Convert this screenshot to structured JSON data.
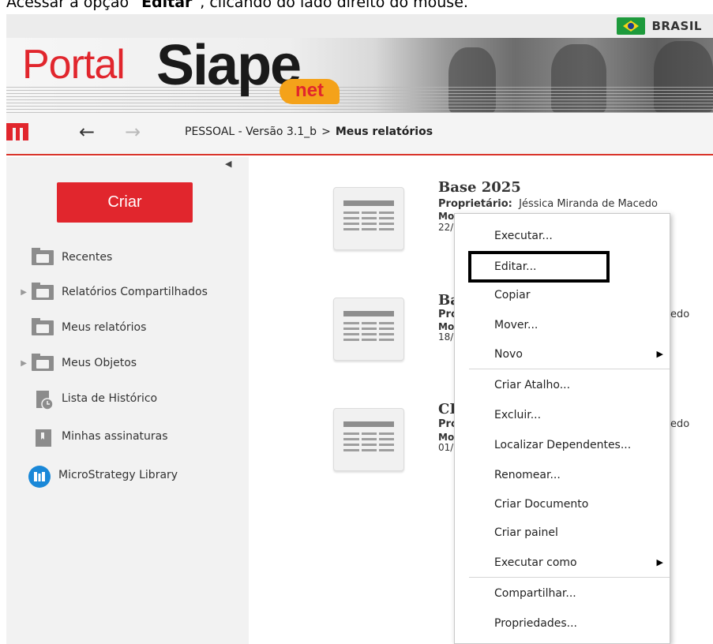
{
  "caption": {
    "text_prefix": "Acessar a opção “",
    "text_bold": "Editar",
    "text_suffix": "”, clicando do lado direito do mouse."
  },
  "topbar": {
    "country_label": "BRASIL",
    "flag_icon": "brazil-flag-icon"
  },
  "banner": {
    "logo_portal": "Portal",
    "logo_siape": "Siape",
    "logo_net": "net"
  },
  "nav": {
    "logo_icon": "microstrategy-m-icon",
    "back_icon": "arrow-left-icon",
    "forward_icon": "arrow-right-icon",
    "breadcrumb_root": "PESSOAL - Versão 3.1_b",
    "breadcrumb_sep": ">",
    "breadcrumb_current": "Meus relatórios"
  },
  "sidebar": {
    "collapse_icon": "collapse-left-icon",
    "create_label": "Criar",
    "items": [
      {
        "label": "Recentes",
        "icon": "clock-folder-icon",
        "expandable": false
      },
      {
        "label": "Relatórios Compartilhados",
        "icon": "shared-folder-icon",
        "expandable": true
      },
      {
        "label": "Meus relatórios",
        "icon": "user-folder-icon",
        "expandable": false
      },
      {
        "label": "Meus Objetos",
        "icon": "objects-folder-icon",
        "expandable": true
      },
      {
        "label": "Lista de Histórico",
        "icon": "history-icon",
        "expandable": false
      },
      {
        "label": "Minhas assinaturas",
        "icon": "bookmark-icon",
        "expandable": false
      },
      {
        "label": "MicroStrategy Library",
        "icon": "library-icon",
        "expandable": false
      }
    ]
  },
  "documents": [
    {
      "title": "Base 2025",
      "owner_label": "Proprietário:",
      "owner": "Jéssica Miranda de Macedo",
      "meta_visible": "Mo",
      "date_visible": "22/("
    },
    {
      "title": "Ba",
      "owner_label": "Pro",
      "owner_tail": "edo",
      "meta_visible": "Mo",
      "date_visible": "18/("
    },
    {
      "title": "CH",
      "owner_label": "Pro",
      "owner_tail": "edo",
      "meta_visible": "Mo",
      "date_visible": "01/("
    }
  ],
  "context_menu": {
    "items": [
      {
        "label": "Executar...",
        "submenu": false
      },
      {
        "label": "Editar...",
        "submenu": false,
        "highlighted": true
      },
      {
        "label": "Copiar",
        "submenu": false
      },
      {
        "label": "Mover...",
        "submenu": false
      },
      {
        "label": "Novo",
        "submenu": true
      },
      {
        "label": "Criar Atalho...",
        "submenu": false
      },
      {
        "label": "Excluir...",
        "submenu": false
      },
      {
        "label": "Localizar Dependentes...",
        "submenu": false
      },
      {
        "label": "Renomear...",
        "submenu": false
      },
      {
        "label": "Criar Documento",
        "submenu": false
      },
      {
        "label": "Criar painel",
        "submenu": false
      },
      {
        "label": "Executar como",
        "submenu": true
      },
      {
        "label": "Compartilhar...",
        "submenu": false
      },
      {
        "label": "Propriedades...",
        "submenu": false
      }
    ],
    "submenu_glyph": "▶"
  },
  "colors": {
    "brand_red": "#e1262d",
    "net_orange": "#f4a21a",
    "library_blue": "#1a88d8",
    "sidebar_bg": "#f2f2f2"
  }
}
